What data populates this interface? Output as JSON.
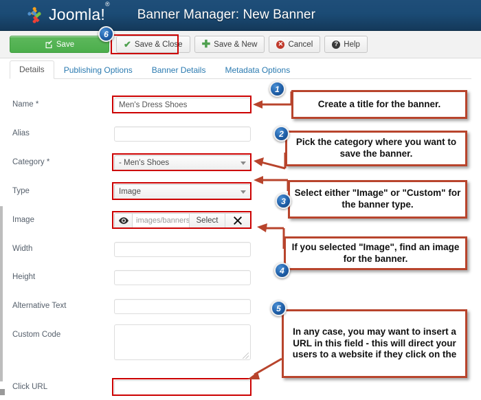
{
  "header": {
    "brand": "Joomla!",
    "brand_sup": "®",
    "title": "Banner Manager: New Banner",
    "brand_logo_icon": "joomla-logo-icon"
  },
  "toolbar": {
    "save_label": "Save",
    "save_close_label": "Save & Close",
    "save_new_label": "Save & New",
    "cancel_label": "Cancel",
    "help_label": "Help",
    "save_icon": "pencil-square-icon",
    "save_close_icon": "check-icon",
    "save_new_icon": "plus-icon",
    "cancel_icon": "cancel-circle-icon",
    "help_icon": "question-circle-icon"
  },
  "tabs": [
    {
      "label": "Details",
      "active": true
    },
    {
      "label": "Publishing Options",
      "active": false
    },
    {
      "label": "Banner Details",
      "active": false
    },
    {
      "label": "Metadata Options",
      "active": false
    }
  ],
  "form": {
    "name": {
      "label": "Name *",
      "value": "Men's Dress Shoes",
      "placeholder": ""
    },
    "alias": {
      "label": "Alias",
      "value": "",
      "placeholder": ""
    },
    "category": {
      "label": "Category *",
      "value": "- Men's Shoes"
    },
    "type": {
      "label": "Type",
      "value": "Image"
    },
    "image": {
      "label": "Image",
      "path_value": "images/banners",
      "select_label": "Select",
      "clear_label": "✕",
      "eye_icon": "eye-icon",
      "clear_icon": "close-x-icon"
    },
    "width": {
      "label": "Width",
      "value": ""
    },
    "height": {
      "label": "Height",
      "value": ""
    },
    "alt_text": {
      "label": "Alternative Text",
      "value": ""
    },
    "custom_code": {
      "label": "Custom Code",
      "value": ""
    },
    "click_url": {
      "label": "Click URL",
      "value": ""
    }
  },
  "annotations": [
    {
      "number": "1",
      "text": "Create a title for the banner."
    },
    {
      "number": "2",
      "text": "Pick the category where you want to save the banner."
    },
    {
      "number": "3",
      "text": "Select either \"Image\" or \"Custom\" for the banner type."
    },
    {
      "number": "4",
      "text": "If you selected \"Image\", find an image for the banner."
    },
    {
      "number": "5",
      "text": "In any case, you may want to insert a URL in this field - this will direct your users to a website if they click on the"
    },
    {
      "number": "6",
      "text": ""
    }
  ],
  "colors": {
    "header_blue": "#1f4e79",
    "save_green": "#4cae4c",
    "highlight_red": "#cc0000",
    "callout_border": "#b8442c",
    "badge_blue": "#1f5fa8",
    "tab_link": "#2a7ab0"
  }
}
